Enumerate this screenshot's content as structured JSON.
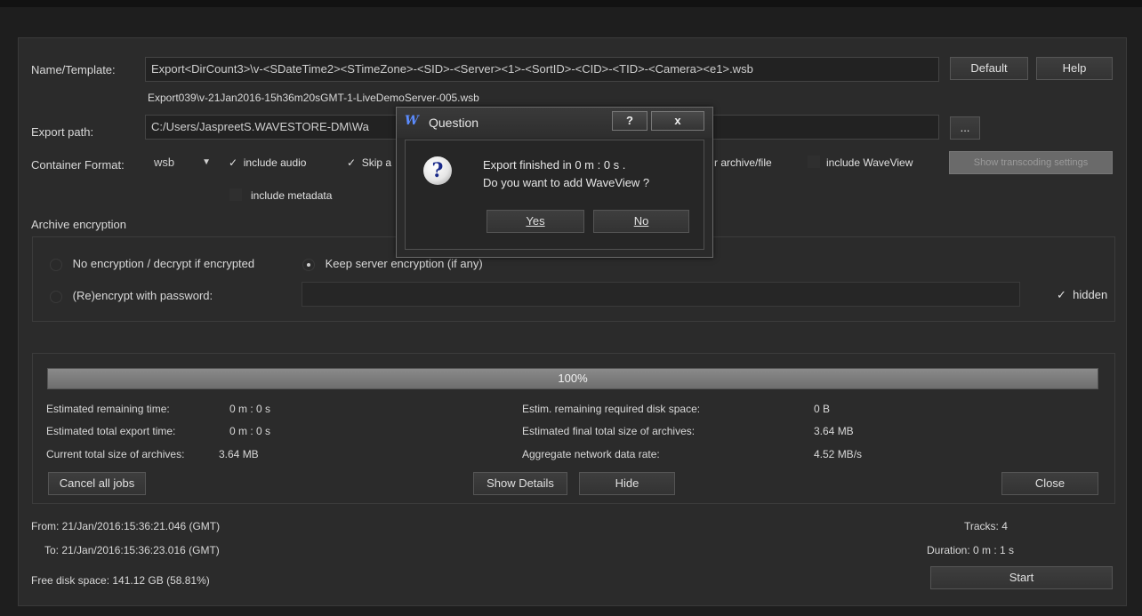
{
  "form": {
    "name_label": "Name/Template:",
    "name_value": "Export<DirCount3>\\v-<SDateTime2><STimeZone>-<SID>-<Server><1>-<SortID>-<CID>-<TID>-<Camera><e1>.wsb",
    "name_preview": "Export039\\v-21Jan2016-15h36m20sGMT-1-LiveDemoServer-005.wsb",
    "default_btn": "Default",
    "help_btn": "Help",
    "path_label": "Export path:",
    "path_value": "C:/Users/JaspreetS.WAVESTORE-DM\\Wa",
    "browse_btn": "...",
    "container_label": "Container Format:",
    "container_value": "wsb",
    "include_audio": "include audio",
    "skip_partial": "Skip a",
    "per_archive": "r archive/file",
    "include_waveview": "include WaveView",
    "show_transcoding": "Show transcoding settings",
    "include_metadata": "include metadata",
    "check_mark": "✓"
  },
  "encryption": {
    "title": "Archive encryption",
    "opt_none": "No encryption / decrypt if encrypted",
    "opt_keep": "Keep server encryption (if any)",
    "opt_reencrypt": "(Re)encrypt with password:",
    "hidden": "hidden"
  },
  "progress": {
    "percent_label": "100%",
    "percent_value": 100,
    "rem_time_label": "Estimated remaining time:",
    "rem_time": "0 m : 0 s",
    "total_time_label": "Estimated total export time:",
    "total_time": "0 m : 0 s",
    "cur_size_label": "Current total size of archives:",
    "cur_size": "3.64 MB",
    "disk_req_label": "Estim. remaining required disk space:",
    "disk_req": "0 B",
    "final_size_label": "Estimated final total size of archives:",
    "final_size": "3.64 MB",
    "rate_label": "Aggregate network data rate:",
    "rate": "4.52 MB/s",
    "cancel_btn": "Cancel all jobs",
    "details_btn": "Show Details",
    "hide_btn": "Hide",
    "close_btn": "Close"
  },
  "footer": {
    "from": "From:  21/Jan/2016:15:36:21.046 (GMT)",
    "to": "To:  21/Jan/2016:15:36:23.016 (GMT)",
    "free": "Free disk space:  141.12 GB (58.81%)",
    "tracks": "Tracks:  4",
    "duration": "Duration:  0 m : 1 s",
    "start_btn": "Start"
  },
  "dialog": {
    "title": "Question",
    "logo": "W",
    "help": "?",
    "close": "x",
    "line1": "Export finished in 0 m : 0 s .",
    "line2": "Do you want to add WaveView ?",
    "yes": "Yes",
    "no": "No"
  }
}
